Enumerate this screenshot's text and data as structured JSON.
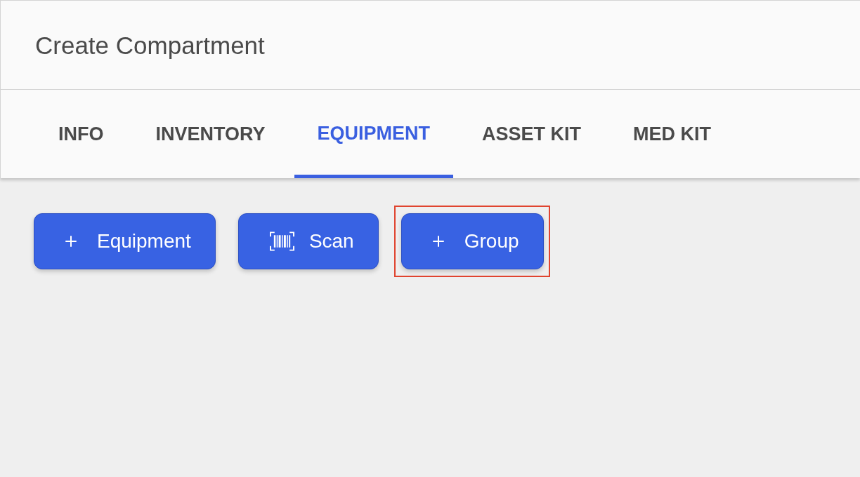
{
  "header": {
    "title": "Create Compartment"
  },
  "tabs": [
    {
      "label": "INFO",
      "selected": false
    },
    {
      "label": "INVENTORY",
      "selected": false
    },
    {
      "label": "EQUIPMENT",
      "selected": true
    },
    {
      "label": "ASSET KIT",
      "selected": false
    },
    {
      "label": "MED KIT",
      "selected": false
    }
  ],
  "actions": [
    {
      "kind": "add",
      "label": "Equipment",
      "highlighted": false
    },
    {
      "kind": "scan",
      "label": "Scan",
      "highlighted": false
    },
    {
      "kind": "add",
      "label": "Group",
      "highlighted": true
    }
  ]
}
